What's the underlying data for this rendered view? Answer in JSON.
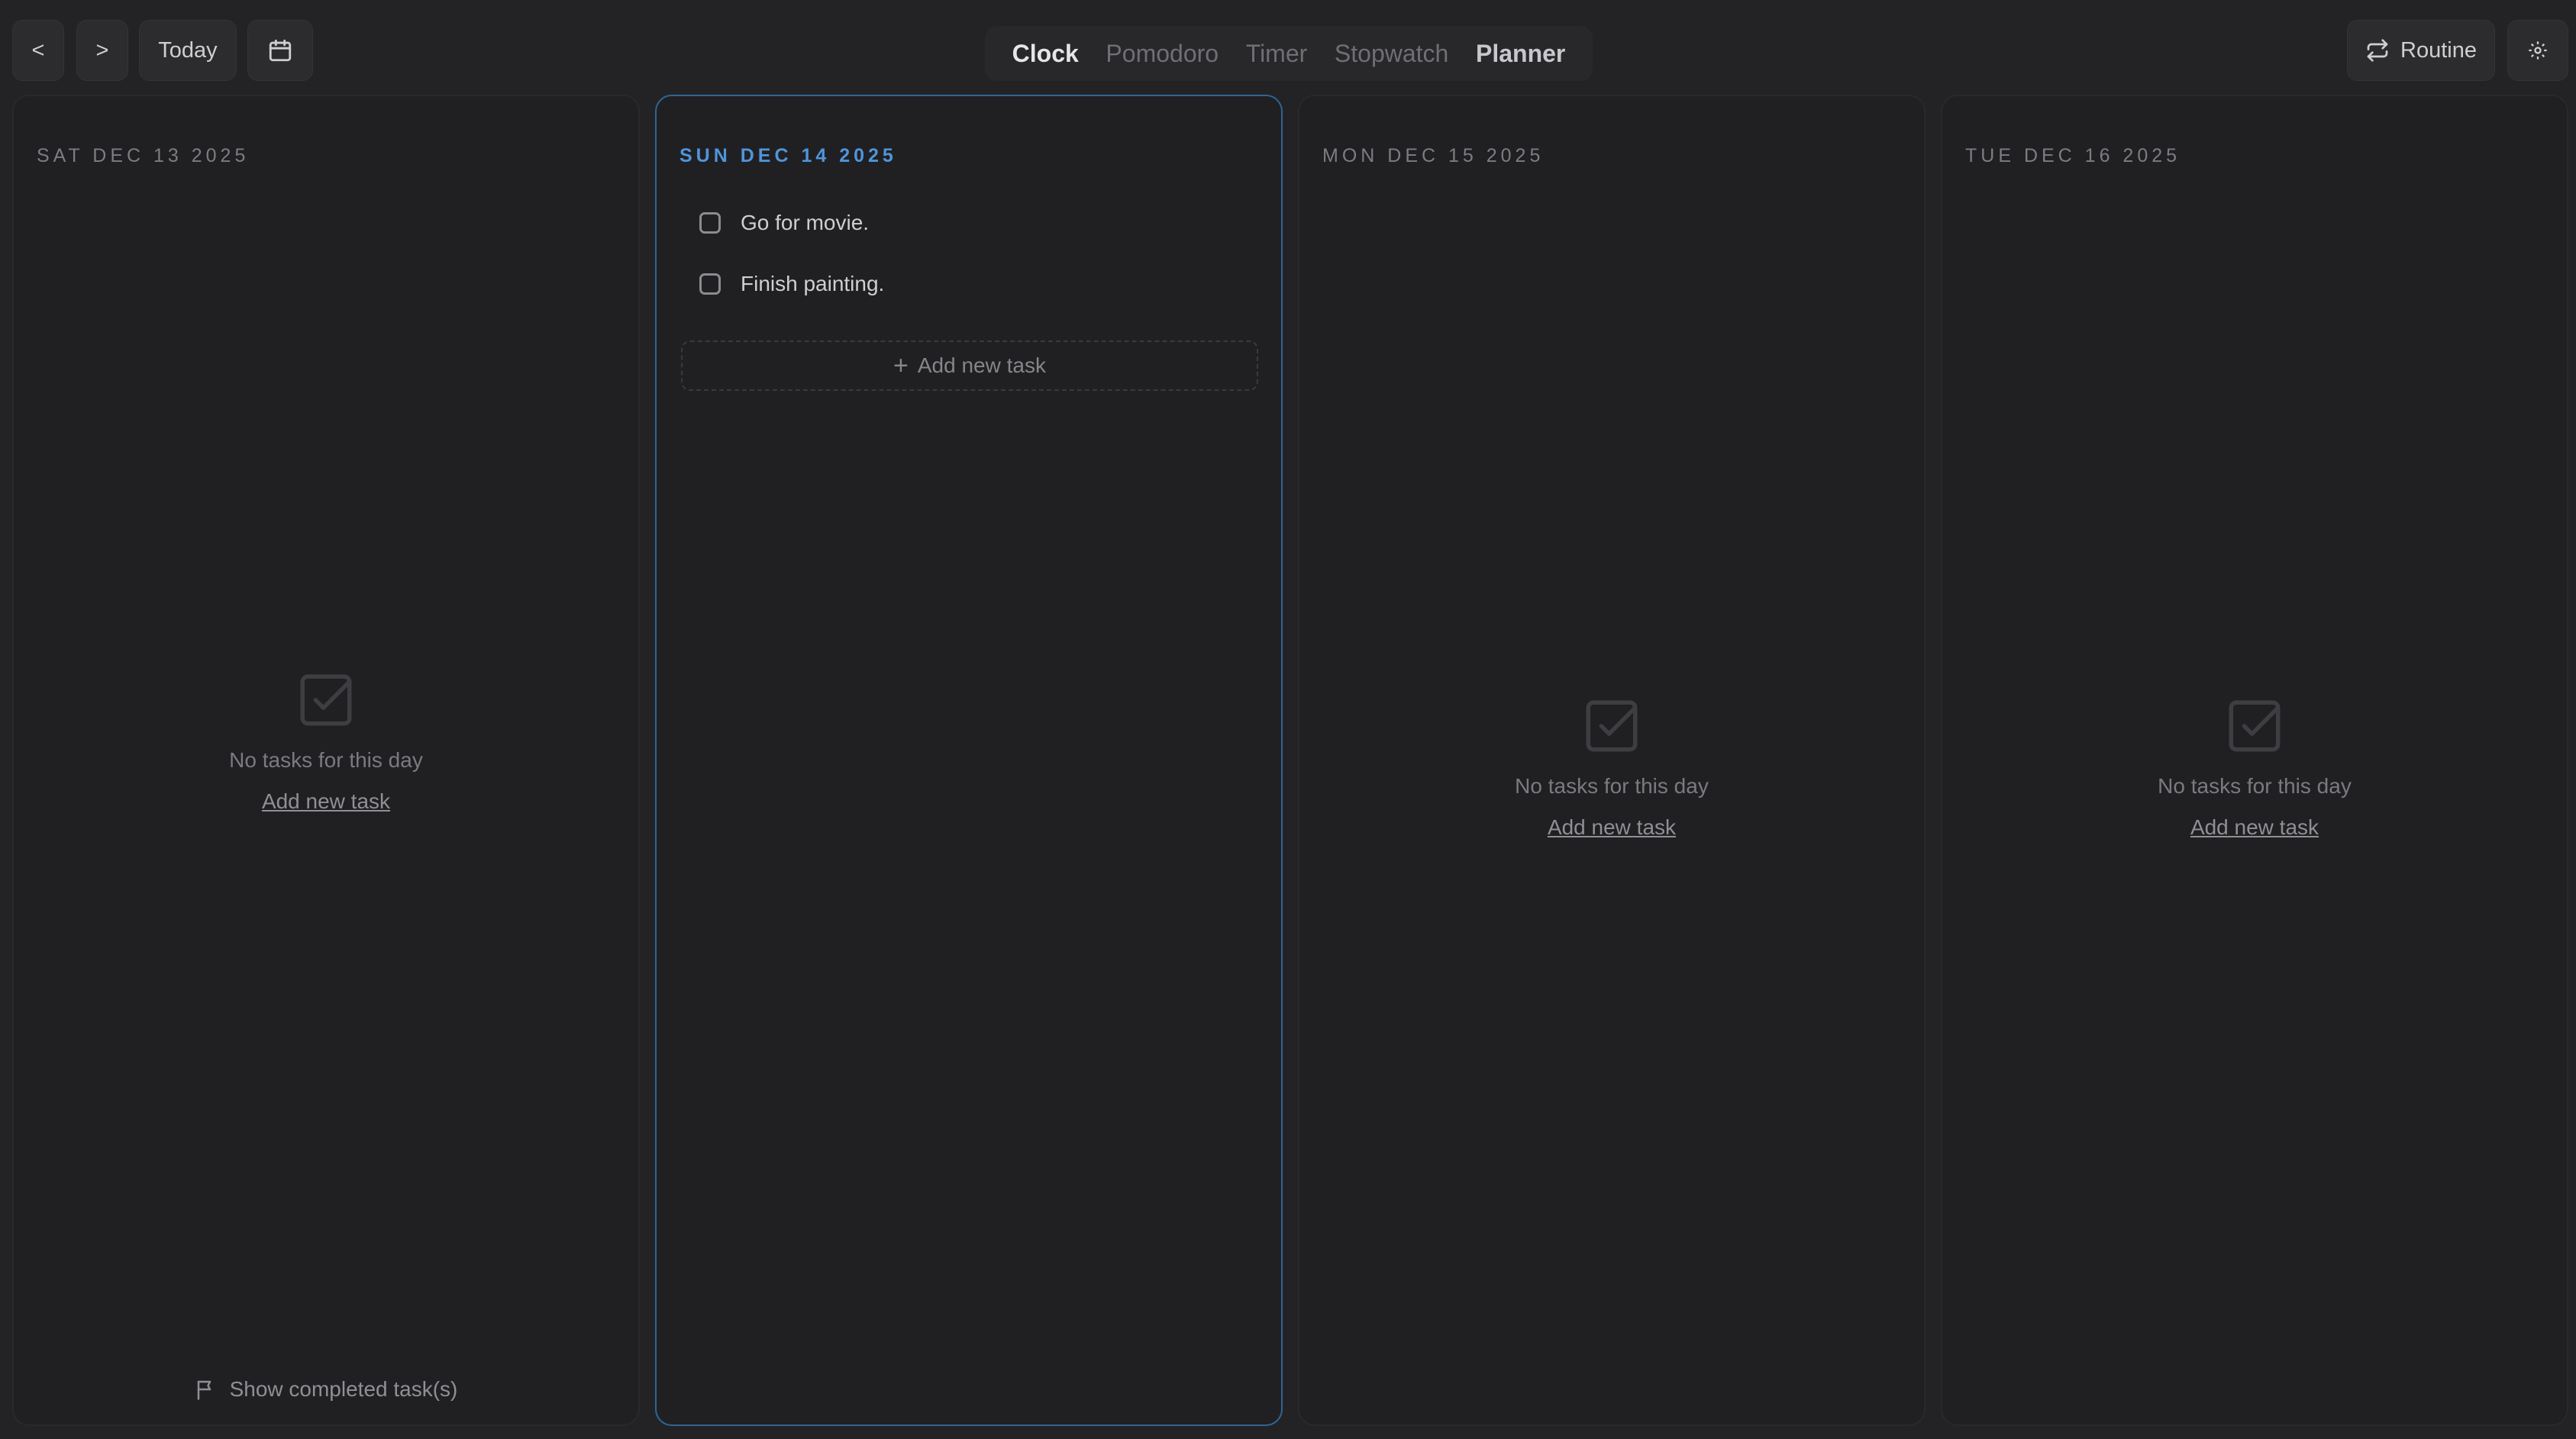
{
  "toolbar": {
    "prev_label": "<",
    "next_label": ">",
    "today_label": "Today",
    "calendar_icon": "calendar-icon",
    "routine_label": "Routine",
    "routine_icon": "repeat-icon",
    "settings_icon": "gear-icon"
  },
  "tabs": [
    {
      "label": "Clock"
    },
    {
      "label": "Pomodoro"
    },
    {
      "label": "Timer"
    },
    {
      "label": "Stopwatch"
    },
    {
      "label": "Planner"
    }
  ],
  "columns": [
    {
      "date": "SAT DEC 13 2025",
      "empty_text": "No tasks for this day",
      "empty_link": "Add new task",
      "show_completed": "Show completed task(s)"
    },
    {
      "date": "SUN DEC 14 2025",
      "tasks": [
        {
          "title": "Go for movie."
        },
        {
          "title": "Finish painting."
        }
      ],
      "add_label": "Add new task"
    },
    {
      "date": "MON DEC 15 2025",
      "empty_text": "No tasks for this day",
      "empty_link": "Add new task"
    },
    {
      "date": "TUE DEC 16 2025",
      "empty_text": "No tasks for this day",
      "empty_link": "Add new task"
    }
  ],
  "colors": {
    "background": "#232325",
    "accent": "#4f95da",
    "selected_border": "#2f6594"
  }
}
